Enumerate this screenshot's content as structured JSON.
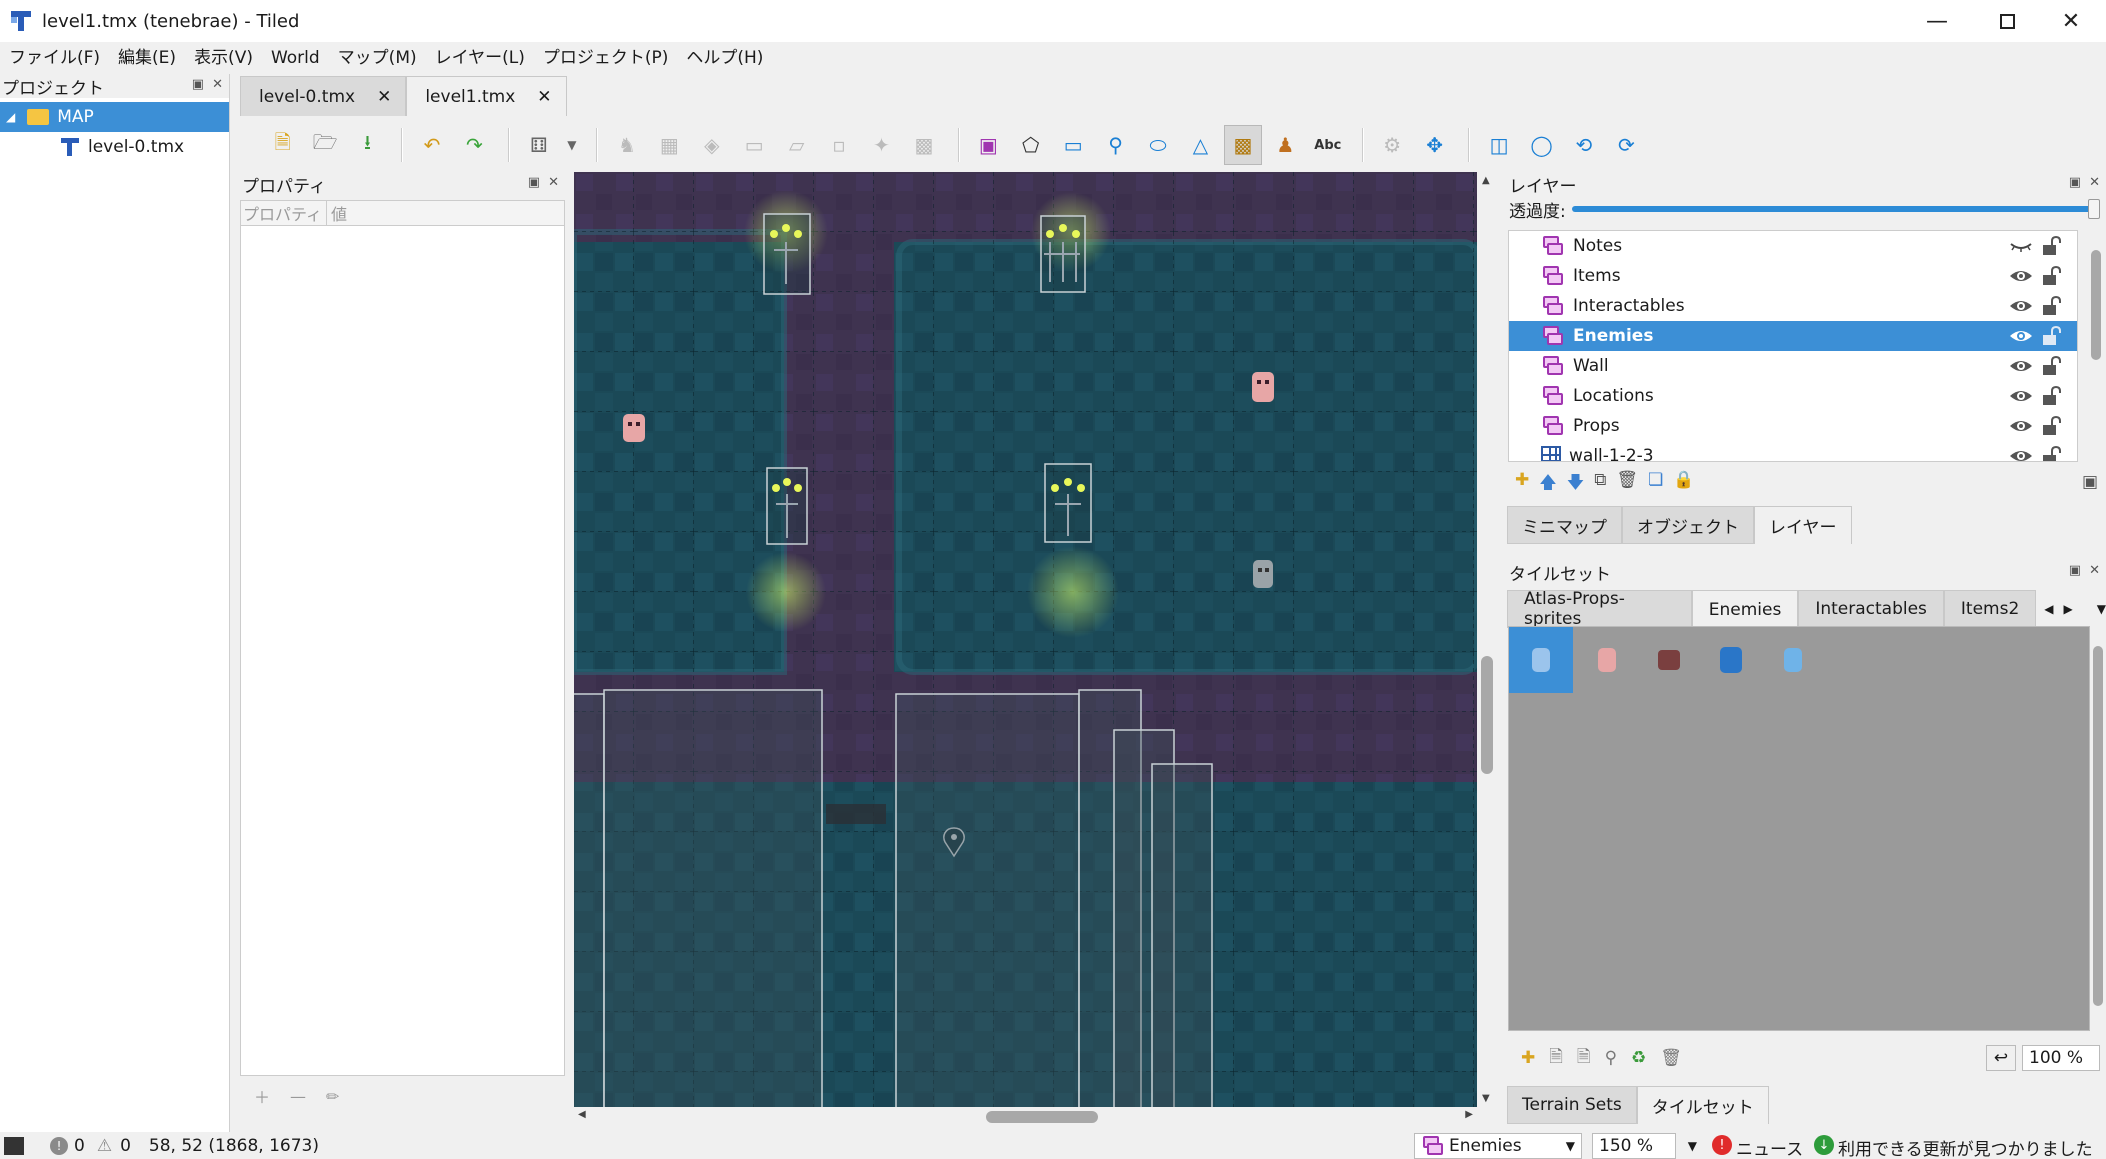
{
  "window": {
    "title": "level1.tmx (tenebrae) - Tiled"
  },
  "menu": [
    "ファイル(F)",
    "編集(E)",
    "表示(V)",
    "World",
    "マップ(M)",
    "レイヤー(L)",
    "プロジェクト(P)",
    "ヘルプ(H)"
  ],
  "project": {
    "title": "プロジェクト",
    "folder": "MAP",
    "file": "level-0.tmx"
  },
  "tabs": [
    {
      "label": "level-0.tmx",
      "active": false
    },
    {
      "label": "level1.tmx",
      "active": true
    }
  ],
  "properties": {
    "title": "プロパティ",
    "col_property": "プロパティ",
    "col_value": "値"
  },
  "layers": {
    "title": "レイヤー",
    "opacity_label": "透過度:",
    "items": [
      {
        "name": "Notes",
        "type": "object",
        "visible": false,
        "selected": false
      },
      {
        "name": "Items",
        "type": "object",
        "visible": true,
        "selected": false
      },
      {
        "name": "Interactables",
        "type": "object",
        "visible": true,
        "selected": false
      },
      {
        "name": "Enemies",
        "type": "object",
        "visible": true,
        "selected": true
      },
      {
        "name": "Wall",
        "type": "object",
        "visible": true,
        "selected": false
      },
      {
        "name": "Locations",
        "type": "object",
        "visible": true,
        "selected": false
      },
      {
        "name": "Props",
        "type": "object",
        "visible": true,
        "selected": false
      },
      {
        "name": "wall-1-2-3",
        "type": "tile",
        "visible": true,
        "selected": false
      }
    ],
    "bottom_tabs": [
      "ミニマップ",
      "オブジェクト",
      "レイヤー"
    ]
  },
  "tilesets": {
    "title": "タイルセット",
    "tabs": [
      "Atlas-Props-sprites",
      "Enemies",
      "Interactables",
      "Items2"
    ],
    "active_tab": "Enemies",
    "zoom": "100 %",
    "bottom_tabs": [
      "Terrain Sets",
      "タイルセット"
    ]
  },
  "status": {
    "errors": "0",
    "warnings": "0",
    "coords": "58, 52 (1868, 1673)",
    "current_layer": "Enemies",
    "zoom": "150 %",
    "news": "ニュース",
    "update": "利用できる更新が見つかりました"
  },
  "colors": {
    "selection": "#3c8fd6",
    "map_floor": "#1b4957",
    "map_path": "#3f3350",
    "object_layer": "#a035b0"
  }
}
